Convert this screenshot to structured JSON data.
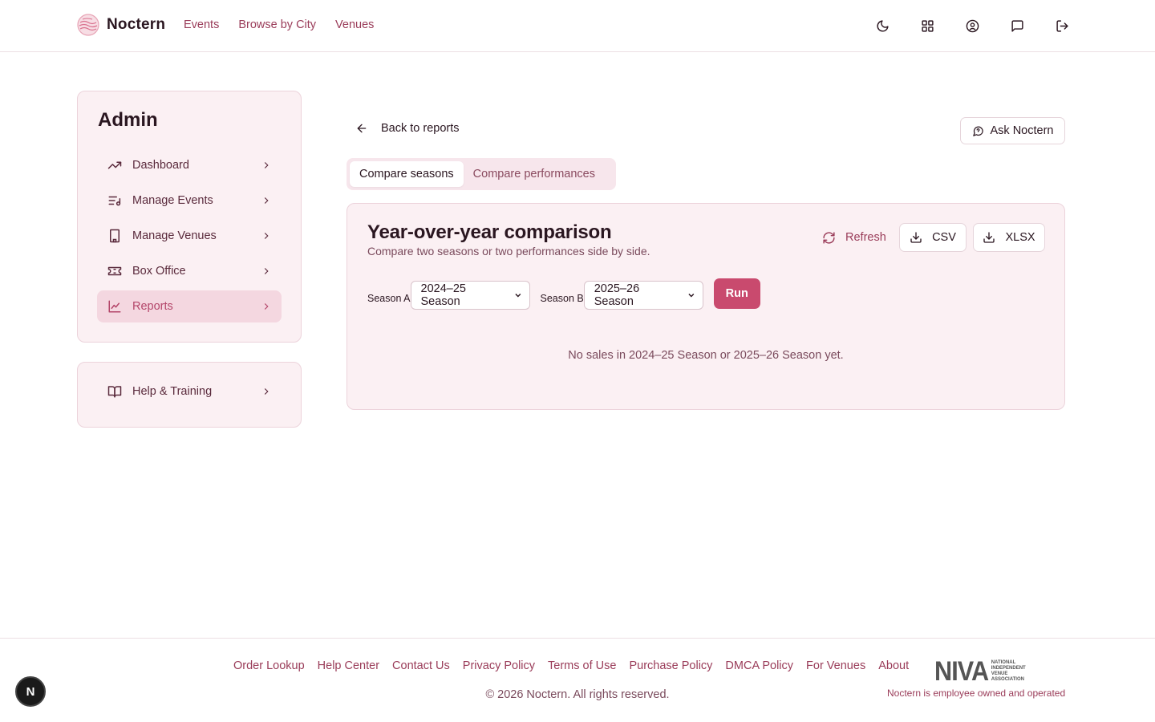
{
  "header": {
    "brand": "Noctern",
    "nav": [
      "Events",
      "Browse by City",
      "Venues"
    ],
    "icons": [
      "moon-icon",
      "grid-icon",
      "user-circle-icon",
      "message-icon",
      "logout-icon"
    ]
  },
  "sidebar": {
    "title": "Admin",
    "items": [
      {
        "label": "Dashboard",
        "icon": "trending-up-icon"
      },
      {
        "label": "Manage Events",
        "icon": "list-music-icon"
      },
      {
        "label": "Manage Venues",
        "icon": "building-icon"
      },
      {
        "label": "Box Office",
        "icon": "ticket-icon"
      },
      {
        "label": "Reports",
        "icon": "line-chart-icon",
        "active": true
      }
    ],
    "help": {
      "label": "Help & Training",
      "icon": "book-open-icon"
    }
  },
  "main": {
    "back_label": "Back to reports",
    "ask_label": "Ask Noctern",
    "tabs": [
      {
        "label": "Compare seasons",
        "active": true
      },
      {
        "label": "Compare performances",
        "active": false
      }
    ],
    "panel": {
      "title": "Year-over-year comparison",
      "subtitle": "Compare two seasons or two performances side by side.",
      "refresh_label": "Refresh",
      "csv_label": "CSV",
      "xlsx_label": "XLSX",
      "season_a_label": "Season A",
      "season_a_value": "2024–25 Season",
      "season_b_label": "Season B",
      "season_b_value": "2025–26 Season",
      "run_label": "Run",
      "empty_message": "No sales in 2024–25 Season or 2025–26 Season yet."
    }
  },
  "footer": {
    "links": [
      "Order Lookup",
      "Help Center",
      "Contact Us",
      "Privacy Policy",
      "Terms of Use",
      "Purchase Policy",
      "DMCA Policy",
      "For Venues",
      "About"
    ],
    "copyright": "© 2026 Noctern. All rights reserved.",
    "niva_logo_text": "NIVA",
    "niva_logo_subtext": "NATIONAL INDEPENDENT VENUE ASSOCIATION",
    "tagline": "Noctern is employee owned and operated"
  },
  "badge": {
    "letter": "N"
  },
  "colors": {
    "accent": "#c94a6e",
    "link": "#9a3c59",
    "panel_bg": "#fbf0f3",
    "active_bg": "#f4d7e0"
  }
}
